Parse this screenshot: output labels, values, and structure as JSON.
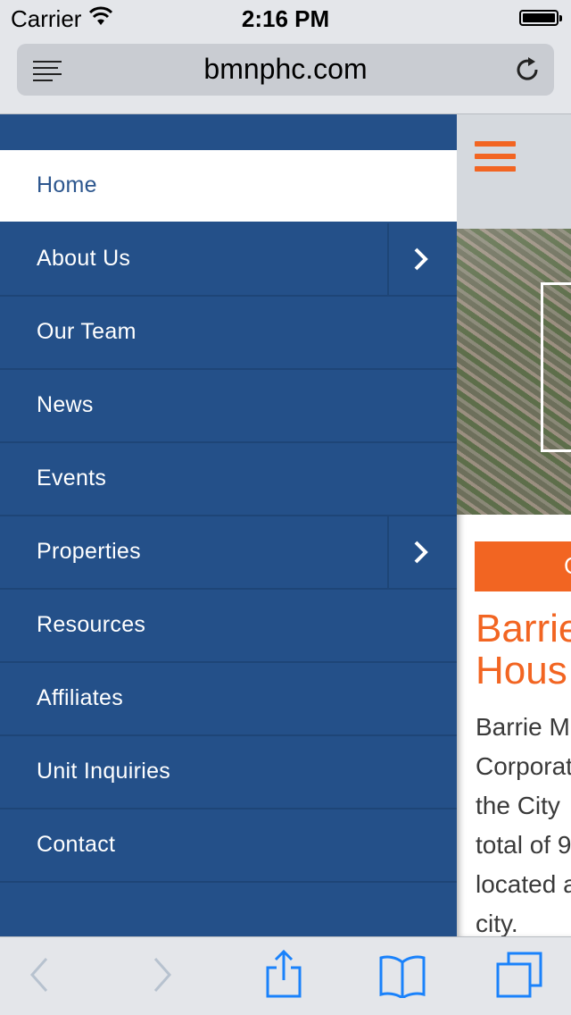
{
  "status_bar": {
    "carrier": "Carrier",
    "time": "2:16 PM"
  },
  "browser": {
    "url": "bmnphc.com"
  },
  "menu": {
    "items": [
      {
        "label": "Home",
        "active": true,
        "has_submenu": false
      },
      {
        "label": "About Us",
        "active": false,
        "has_submenu": true
      },
      {
        "label": "Our Team",
        "active": false,
        "has_submenu": false
      },
      {
        "label": "News",
        "active": false,
        "has_submenu": false
      },
      {
        "label": "Events",
        "active": false,
        "has_submenu": false
      },
      {
        "label": "Properties",
        "active": false,
        "has_submenu": true
      },
      {
        "label": "Resources",
        "active": false,
        "has_submenu": false
      },
      {
        "label": "Affiliates",
        "active": false,
        "has_submenu": false
      },
      {
        "label": "Unit Inquiries",
        "active": false,
        "has_submenu": false
      },
      {
        "label": "Contact",
        "active": false,
        "has_submenu": false
      }
    ]
  },
  "page": {
    "button_label": "C",
    "title_line1": "Barrie",
    "title_line2": "Hous",
    "body_lines": [
      "Barrie M",
      "Corporat",
      "the City",
      "total of 9",
      "located a",
      "city."
    ]
  },
  "toolbar": {
    "icons": [
      "back-icon",
      "forward-icon",
      "share-icon",
      "bookmarks-icon",
      "tabs-icon"
    ]
  },
  "colors": {
    "menu_bg": "#245089",
    "accent": "#f26522",
    "chrome_bg": "#e4e6ea",
    "ios_blue": "#1a82fb"
  }
}
